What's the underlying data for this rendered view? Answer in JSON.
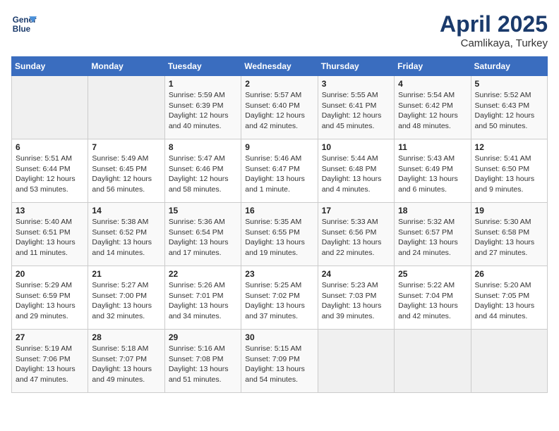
{
  "logo": {
    "line1": "General",
    "line2": "Blue"
  },
  "title": "April 2025",
  "subtitle": "Camlikaya, Turkey",
  "weekdays": [
    "Sunday",
    "Monday",
    "Tuesday",
    "Wednesday",
    "Thursday",
    "Friday",
    "Saturday"
  ],
  "weeks": [
    [
      {
        "day": "",
        "info": ""
      },
      {
        "day": "",
        "info": ""
      },
      {
        "day": "1",
        "info": "Sunrise: 5:59 AM\nSunset: 6:39 PM\nDaylight: 12 hours and 40 minutes."
      },
      {
        "day": "2",
        "info": "Sunrise: 5:57 AM\nSunset: 6:40 PM\nDaylight: 12 hours and 42 minutes."
      },
      {
        "day": "3",
        "info": "Sunrise: 5:55 AM\nSunset: 6:41 PM\nDaylight: 12 hours and 45 minutes."
      },
      {
        "day": "4",
        "info": "Sunrise: 5:54 AM\nSunset: 6:42 PM\nDaylight: 12 hours and 48 minutes."
      },
      {
        "day": "5",
        "info": "Sunrise: 5:52 AM\nSunset: 6:43 PM\nDaylight: 12 hours and 50 minutes."
      }
    ],
    [
      {
        "day": "6",
        "info": "Sunrise: 5:51 AM\nSunset: 6:44 PM\nDaylight: 12 hours and 53 minutes."
      },
      {
        "day": "7",
        "info": "Sunrise: 5:49 AM\nSunset: 6:45 PM\nDaylight: 12 hours and 56 minutes."
      },
      {
        "day": "8",
        "info": "Sunrise: 5:47 AM\nSunset: 6:46 PM\nDaylight: 12 hours and 58 minutes."
      },
      {
        "day": "9",
        "info": "Sunrise: 5:46 AM\nSunset: 6:47 PM\nDaylight: 13 hours and 1 minute."
      },
      {
        "day": "10",
        "info": "Sunrise: 5:44 AM\nSunset: 6:48 PM\nDaylight: 13 hours and 4 minutes."
      },
      {
        "day": "11",
        "info": "Sunrise: 5:43 AM\nSunset: 6:49 PM\nDaylight: 13 hours and 6 minutes."
      },
      {
        "day": "12",
        "info": "Sunrise: 5:41 AM\nSunset: 6:50 PM\nDaylight: 13 hours and 9 minutes."
      }
    ],
    [
      {
        "day": "13",
        "info": "Sunrise: 5:40 AM\nSunset: 6:51 PM\nDaylight: 13 hours and 11 minutes."
      },
      {
        "day": "14",
        "info": "Sunrise: 5:38 AM\nSunset: 6:52 PM\nDaylight: 13 hours and 14 minutes."
      },
      {
        "day": "15",
        "info": "Sunrise: 5:36 AM\nSunset: 6:54 PM\nDaylight: 13 hours and 17 minutes."
      },
      {
        "day": "16",
        "info": "Sunrise: 5:35 AM\nSunset: 6:55 PM\nDaylight: 13 hours and 19 minutes."
      },
      {
        "day": "17",
        "info": "Sunrise: 5:33 AM\nSunset: 6:56 PM\nDaylight: 13 hours and 22 minutes."
      },
      {
        "day": "18",
        "info": "Sunrise: 5:32 AM\nSunset: 6:57 PM\nDaylight: 13 hours and 24 minutes."
      },
      {
        "day": "19",
        "info": "Sunrise: 5:30 AM\nSunset: 6:58 PM\nDaylight: 13 hours and 27 minutes."
      }
    ],
    [
      {
        "day": "20",
        "info": "Sunrise: 5:29 AM\nSunset: 6:59 PM\nDaylight: 13 hours and 29 minutes."
      },
      {
        "day": "21",
        "info": "Sunrise: 5:27 AM\nSunset: 7:00 PM\nDaylight: 13 hours and 32 minutes."
      },
      {
        "day": "22",
        "info": "Sunrise: 5:26 AM\nSunset: 7:01 PM\nDaylight: 13 hours and 34 minutes."
      },
      {
        "day": "23",
        "info": "Sunrise: 5:25 AM\nSunset: 7:02 PM\nDaylight: 13 hours and 37 minutes."
      },
      {
        "day": "24",
        "info": "Sunrise: 5:23 AM\nSunset: 7:03 PM\nDaylight: 13 hours and 39 minutes."
      },
      {
        "day": "25",
        "info": "Sunrise: 5:22 AM\nSunset: 7:04 PM\nDaylight: 13 hours and 42 minutes."
      },
      {
        "day": "26",
        "info": "Sunrise: 5:20 AM\nSunset: 7:05 PM\nDaylight: 13 hours and 44 minutes."
      }
    ],
    [
      {
        "day": "27",
        "info": "Sunrise: 5:19 AM\nSunset: 7:06 PM\nDaylight: 13 hours and 47 minutes."
      },
      {
        "day": "28",
        "info": "Sunrise: 5:18 AM\nSunset: 7:07 PM\nDaylight: 13 hours and 49 minutes."
      },
      {
        "day": "29",
        "info": "Sunrise: 5:16 AM\nSunset: 7:08 PM\nDaylight: 13 hours and 51 minutes."
      },
      {
        "day": "30",
        "info": "Sunrise: 5:15 AM\nSunset: 7:09 PM\nDaylight: 13 hours and 54 minutes."
      },
      {
        "day": "",
        "info": ""
      },
      {
        "day": "",
        "info": ""
      },
      {
        "day": "",
        "info": ""
      }
    ]
  ]
}
